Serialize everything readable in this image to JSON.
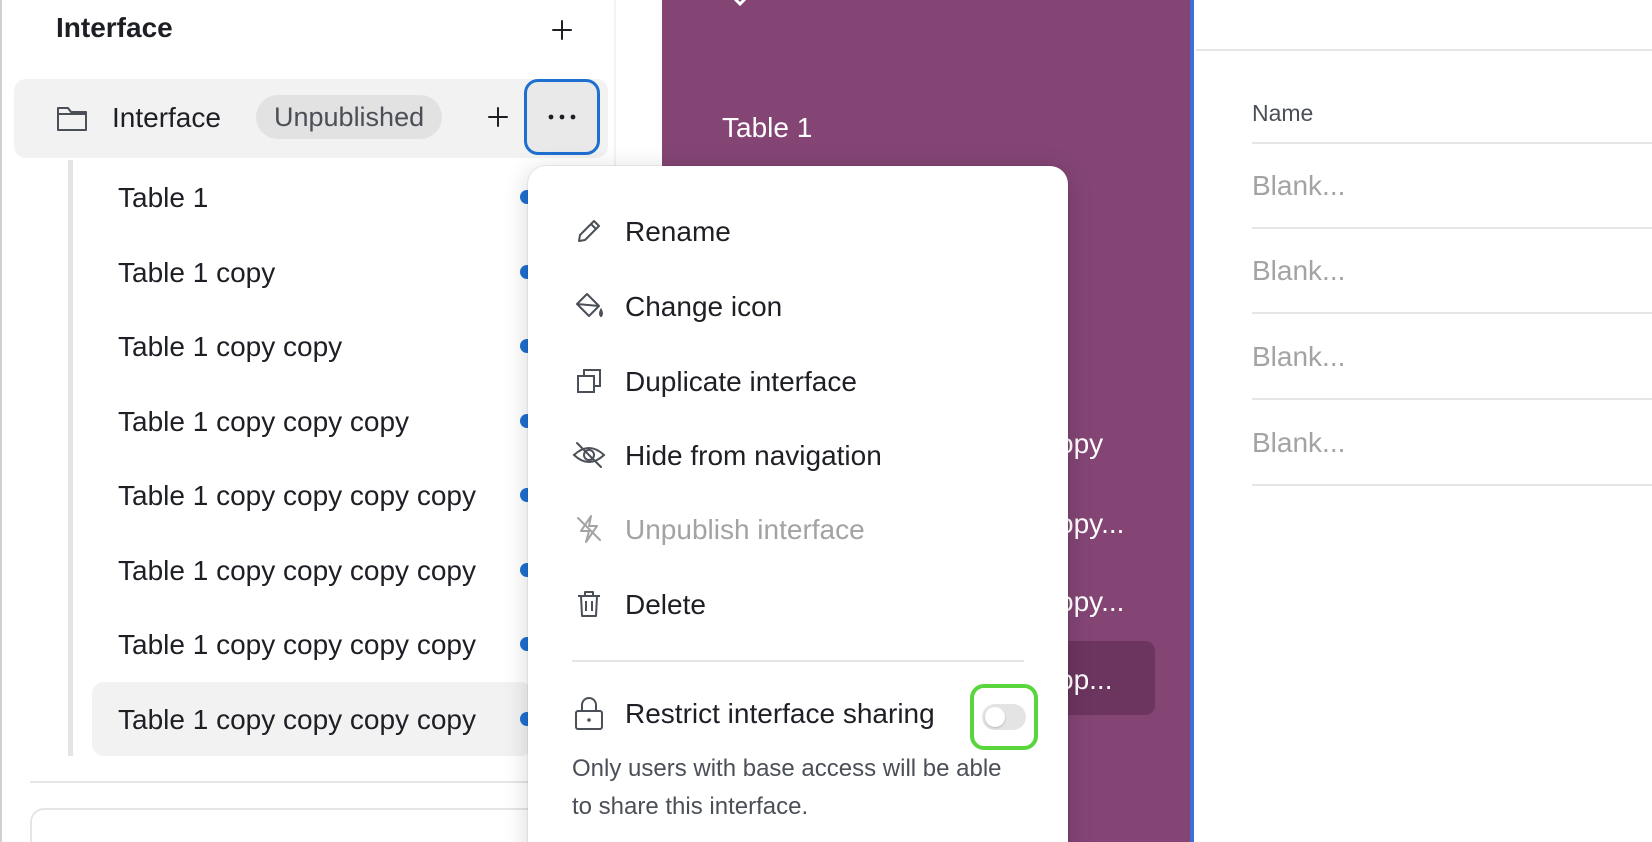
{
  "sidebar": {
    "title": "Interface",
    "interface_row": {
      "name": "Interface",
      "status_badge": "Unpublished"
    },
    "tables": [
      {
        "label": "Table 1"
      },
      {
        "label": "Table 1 copy"
      },
      {
        "label": "Table 1 copy copy"
      },
      {
        "label": "Table 1 copy copy copy"
      },
      {
        "label": "Table 1 copy copy copy copy"
      },
      {
        "label": "Table 1 copy copy copy copy"
      },
      {
        "label": "Table 1 copy copy copy copy"
      },
      {
        "label": "Table 1 copy copy copy copy"
      }
    ]
  },
  "preview": {
    "items": [
      "Table 1",
      "opy",
      "opy...",
      "opy...",
      "op..."
    ],
    "background_color": "#844575"
  },
  "grid": {
    "header": "Name",
    "cells": [
      "Blank...",
      "Blank...",
      "Blank...",
      "Blank..."
    ]
  },
  "menu": {
    "items": [
      {
        "label": "Rename",
        "icon": "pencil-icon",
        "disabled": false
      },
      {
        "label": "Change icon",
        "icon": "paint-bucket-icon",
        "disabled": false
      },
      {
        "label": "Duplicate interface",
        "icon": "duplicate-icon",
        "disabled": false
      },
      {
        "label": "Hide from navigation",
        "icon": "eye-slash-icon",
        "disabled": false
      },
      {
        "label": "Unpublish interface",
        "icon": "lightning-slash-icon",
        "disabled": true
      },
      {
        "label": "Delete",
        "icon": "trash-icon",
        "disabled": false
      }
    ],
    "restrict": {
      "label": "Restrict interface sharing",
      "description": "Only users with base access will be able to share this interface.",
      "enabled": false
    }
  },
  "colors": {
    "accent_blue": "#1f6fd1",
    "highlight_green": "#59d63c",
    "purple": "#844575"
  }
}
